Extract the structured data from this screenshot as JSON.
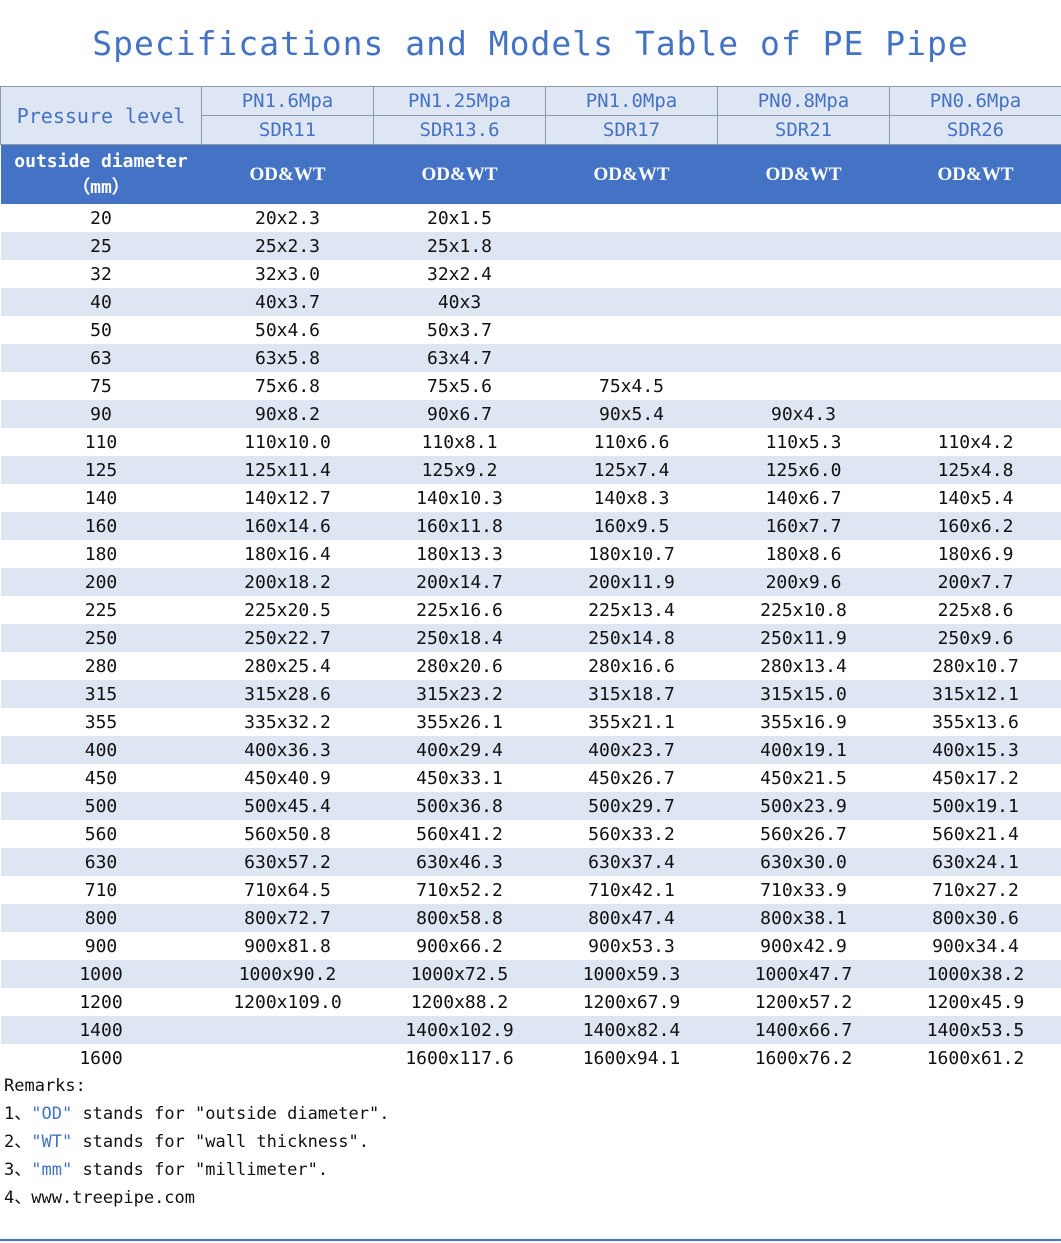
{
  "title": "Specifications and Models Table of PE Pipe",
  "header": {
    "pressure_label": "Pressure level",
    "pressures": [
      "PN1.6Mpa",
      "PN1.25Mpa",
      "PN1.0Mpa",
      "PN0.8Mpa",
      "PN0.6Mpa"
    ],
    "sdrs": [
      "SDR11",
      "SDR13.6",
      "SDR17",
      "SDR21",
      "SDR26"
    ],
    "od_label_line1": "outside diameter",
    "od_label_line2": "（mm）",
    "odwt": "OD&WT"
  },
  "rows": [
    [
      "20",
      "20x2.3",
      "20x1.5",
      "",
      "",
      ""
    ],
    [
      "25",
      "25x2.3",
      "25x1.8",
      "",
      "",
      ""
    ],
    [
      "32",
      "32x3.0",
      "32x2.4",
      "",
      "",
      ""
    ],
    [
      "40",
      "40x3.7",
      "40x3",
      "",
      "",
      ""
    ],
    [
      "50",
      "50x4.6",
      "50x3.7",
      "",
      "",
      ""
    ],
    [
      "63",
      "63x5.8",
      "63x4.7",
      "",
      "",
      ""
    ],
    [
      "75",
      "75x6.8",
      "75x5.6",
      "75x4.5",
      "",
      ""
    ],
    [
      "90",
      "90x8.2",
      "90x6.7",
      "90x5.4",
      "90x4.3",
      ""
    ],
    [
      "110",
      "110x10.0",
      "110x8.1",
      "110x6.6",
      "110x5.3",
      "110x4.2"
    ],
    [
      "125",
      "125x11.4",
      "125x9.2",
      "125x7.4",
      "125x6.0",
      "125x4.8"
    ],
    [
      "140",
      "140x12.7",
      "140x10.3",
      "140x8.3",
      "140x6.7",
      "140x5.4"
    ],
    [
      "160",
      "160x14.6",
      "160x11.8",
      "160x9.5",
      "160x7.7",
      "160x6.2"
    ],
    [
      "180",
      "180x16.4",
      "180x13.3",
      "180x10.7",
      "180x8.6",
      "180x6.9"
    ],
    [
      "200",
      "200x18.2",
      "200x14.7",
      "200x11.9",
      "200x9.6",
      "200x7.7"
    ],
    [
      "225",
      "225x20.5",
      "225x16.6",
      "225x13.4",
      "225x10.8",
      "225x8.6"
    ],
    [
      "250",
      "250x22.7",
      "250x18.4",
      "250x14.8",
      "250x11.9",
      "250x9.6"
    ],
    [
      "280",
      "280x25.4",
      "280x20.6",
      "280x16.6",
      "280x13.4",
      "280x10.7"
    ],
    [
      "315",
      "315x28.6",
      "315x23.2",
      "315x18.7",
      "315x15.0",
      "315x12.1"
    ],
    [
      "355",
      "335x32.2",
      "355x26.1",
      "355x21.1",
      "355x16.9",
      "355x13.6"
    ],
    [
      "400",
      "400x36.3",
      "400x29.4",
      "400x23.7",
      "400x19.1",
      "400x15.3"
    ],
    [
      "450",
      "450x40.9",
      "450x33.1",
      "450x26.7",
      "450x21.5",
      "450x17.2"
    ],
    [
      "500",
      "500x45.4",
      "500x36.8",
      "500x29.7",
      "500x23.9",
      "500x19.1"
    ],
    [
      "560",
      "560x50.8",
      "560x41.2",
      "560x33.2",
      "560x26.7",
      "560x21.4"
    ],
    [
      "630",
      "630x57.2",
      "630x46.3",
      "630x37.4",
      "630x30.0",
      "630x24.1"
    ],
    [
      "710",
      "710x64.5",
      "710x52.2",
      "710x42.1",
      "710x33.9",
      "710x27.2"
    ],
    [
      "800",
      "800x72.7",
      "800x58.8",
      "800x47.4",
      "800x38.1",
      "800x30.6"
    ],
    [
      "900",
      "900x81.8",
      "900x66.2",
      "900x53.3",
      "900x42.9",
      "900x34.4"
    ],
    [
      "1000",
      "1000x90.2",
      "1000x72.5",
      "1000x59.3",
      "1000x47.7",
      "1000x38.2"
    ],
    [
      "1200",
      "1200x109.0",
      "1200x88.2",
      "1200x67.9",
      "1200x57.2",
      "1200x45.9"
    ],
    [
      "1400",
      "",
      "1400x102.9",
      "1400x82.4",
      "1400x66.7",
      "1400x53.5"
    ],
    [
      "1600",
      "",
      "1600x117.6",
      "1600x94.1",
      "1600x76.2",
      "1600x61.2"
    ]
  ],
  "remarks": {
    "heading": "Remarks:",
    "items": [
      {
        "prefix": "1、",
        "term": "\"OD\"",
        "text": " stands for \"outside diameter\"."
      },
      {
        "prefix": "2、",
        "term": "\"WT\"",
        "text": " stands for \"wall thickness\"."
      },
      {
        "prefix": "3、",
        "term": "\"mm\"",
        "text": " stands for \"millimeter\"."
      },
      {
        "prefix": "4、",
        "term": "",
        "text": "www.treepipe.com"
      }
    ]
  },
  "colors": {
    "accent": "#4472c4",
    "header_fill": "#dde6f2",
    "stripe_fill": "#dde6f2"
  }
}
